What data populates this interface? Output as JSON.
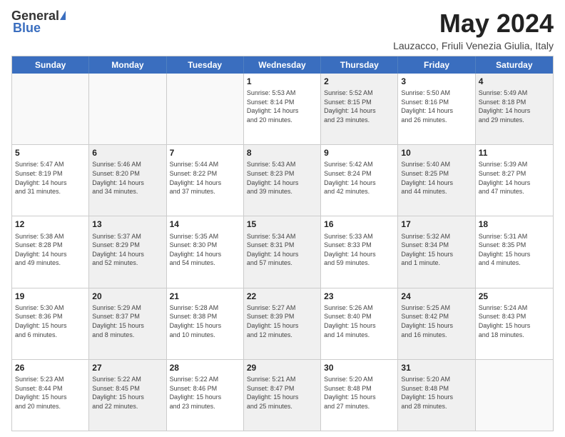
{
  "logo": {
    "general": "General",
    "blue": "Blue"
  },
  "title": "May 2024",
  "subtitle": "Lauzacco, Friuli Venezia Giulia, Italy",
  "header_days": [
    "Sunday",
    "Monday",
    "Tuesday",
    "Wednesday",
    "Thursday",
    "Friday",
    "Saturday"
  ],
  "rows": [
    [
      {
        "day": "",
        "info": "",
        "shaded": false,
        "empty": true
      },
      {
        "day": "",
        "info": "",
        "shaded": false,
        "empty": true
      },
      {
        "day": "",
        "info": "",
        "shaded": false,
        "empty": true
      },
      {
        "day": "1",
        "info": "Sunrise: 5:53 AM\nSunset: 8:14 PM\nDaylight: 14 hours\nand 20 minutes.",
        "shaded": false,
        "empty": false
      },
      {
        "day": "2",
        "info": "Sunrise: 5:52 AM\nSunset: 8:15 PM\nDaylight: 14 hours\nand 23 minutes.",
        "shaded": true,
        "empty": false
      },
      {
        "day": "3",
        "info": "Sunrise: 5:50 AM\nSunset: 8:16 PM\nDaylight: 14 hours\nand 26 minutes.",
        "shaded": false,
        "empty": false
      },
      {
        "day": "4",
        "info": "Sunrise: 5:49 AM\nSunset: 8:18 PM\nDaylight: 14 hours\nand 29 minutes.",
        "shaded": true,
        "empty": false
      }
    ],
    [
      {
        "day": "5",
        "info": "Sunrise: 5:47 AM\nSunset: 8:19 PM\nDaylight: 14 hours\nand 31 minutes.",
        "shaded": false,
        "empty": false
      },
      {
        "day": "6",
        "info": "Sunrise: 5:46 AM\nSunset: 8:20 PM\nDaylight: 14 hours\nand 34 minutes.",
        "shaded": true,
        "empty": false
      },
      {
        "day": "7",
        "info": "Sunrise: 5:44 AM\nSunset: 8:22 PM\nDaylight: 14 hours\nand 37 minutes.",
        "shaded": false,
        "empty": false
      },
      {
        "day": "8",
        "info": "Sunrise: 5:43 AM\nSunset: 8:23 PM\nDaylight: 14 hours\nand 39 minutes.",
        "shaded": true,
        "empty": false
      },
      {
        "day": "9",
        "info": "Sunrise: 5:42 AM\nSunset: 8:24 PM\nDaylight: 14 hours\nand 42 minutes.",
        "shaded": false,
        "empty": false
      },
      {
        "day": "10",
        "info": "Sunrise: 5:40 AM\nSunset: 8:25 PM\nDaylight: 14 hours\nand 44 minutes.",
        "shaded": true,
        "empty": false
      },
      {
        "day": "11",
        "info": "Sunrise: 5:39 AM\nSunset: 8:27 PM\nDaylight: 14 hours\nand 47 minutes.",
        "shaded": false,
        "empty": false
      }
    ],
    [
      {
        "day": "12",
        "info": "Sunrise: 5:38 AM\nSunset: 8:28 PM\nDaylight: 14 hours\nand 49 minutes.",
        "shaded": false,
        "empty": false
      },
      {
        "day": "13",
        "info": "Sunrise: 5:37 AM\nSunset: 8:29 PM\nDaylight: 14 hours\nand 52 minutes.",
        "shaded": true,
        "empty": false
      },
      {
        "day": "14",
        "info": "Sunrise: 5:35 AM\nSunset: 8:30 PM\nDaylight: 14 hours\nand 54 minutes.",
        "shaded": false,
        "empty": false
      },
      {
        "day": "15",
        "info": "Sunrise: 5:34 AM\nSunset: 8:31 PM\nDaylight: 14 hours\nand 57 minutes.",
        "shaded": true,
        "empty": false
      },
      {
        "day": "16",
        "info": "Sunrise: 5:33 AM\nSunset: 8:33 PM\nDaylight: 14 hours\nand 59 minutes.",
        "shaded": false,
        "empty": false
      },
      {
        "day": "17",
        "info": "Sunrise: 5:32 AM\nSunset: 8:34 PM\nDaylight: 15 hours\nand 1 minute.",
        "shaded": true,
        "empty": false
      },
      {
        "day": "18",
        "info": "Sunrise: 5:31 AM\nSunset: 8:35 PM\nDaylight: 15 hours\nand 4 minutes.",
        "shaded": false,
        "empty": false
      }
    ],
    [
      {
        "day": "19",
        "info": "Sunrise: 5:30 AM\nSunset: 8:36 PM\nDaylight: 15 hours\nand 6 minutes.",
        "shaded": false,
        "empty": false
      },
      {
        "day": "20",
        "info": "Sunrise: 5:29 AM\nSunset: 8:37 PM\nDaylight: 15 hours\nand 8 minutes.",
        "shaded": true,
        "empty": false
      },
      {
        "day": "21",
        "info": "Sunrise: 5:28 AM\nSunset: 8:38 PM\nDaylight: 15 hours\nand 10 minutes.",
        "shaded": false,
        "empty": false
      },
      {
        "day": "22",
        "info": "Sunrise: 5:27 AM\nSunset: 8:39 PM\nDaylight: 15 hours\nand 12 minutes.",
        "shaded": true,
        "empty": false
      },
      {
        "day": "23",
        "info": "Sunrise: 5:26 AM\nSunset: 8:40 PM\nDaylight: 15 hours\nand 14 minutes.",
        "shaded": false,
        "empty": false
      },
      {
        "day": "24",
        "info": "Sunrise: 5:25 AM\nSunset: 8:42 PM\nDaylight: 15 hours\nand 16 minutes.",
        "shaded": true,
        "empty": false
      },
      {
        "day": "25",
        "info": "Sunrise: 5:24 AM\nSunset: 8:43 PM\nDaylight: 15 hours\nand 18 minutes.",
        "shaded": false,
        "empty": false
      }
    ],
    [
      {
        "day": "26",
        "info": "Sunrise: 5:23 AM\nSunset: 8:44 PM\nDaylight: 15 hours\nand 20 minutes.",
        "shaded": false,
        "empty": false
      },
      {
        "day": "27",
        "info": "Sunrise: 5:22 AM\nSunset: 8:45 PM\nDaylight: 15 hours\nand 22 minutes.",
        "shaded": true,
        "empty": false
      },
      {
        "day": "28",
        "info": "Sunrise: 5:22 AM\nSunset: 8:46 PM\nDaylight: 15 hours\nand 23 minutes.",
        "shaded": false,
        "empty": false
      },
      {
        "day": "29",
        "info": "Sunrise: 5:21 AM\nSunset: 8:47 PM\nDaylight: 15 hours\nand 25 minutes.",
        "shaded": true,
        "empty": false
      },
      {
        "day": "30",
        "info": "Sunrise: 5:20 AM\nSunset: 8:48 PM\nDaylight: 15 hours\nand 27 minutes.",
        "shaded": false,
        "empty": false
      },
      {
        "day": "31",
        "info": "Sunrise: 5:20 AM\nSunset: 8:48 PM\nDaylight: 15 hours\nand 28 minutes.",
        "shaded": true,
        "empty": false
      },
      {
        "day": "",
        "info": "",
        "shaded": false,
        "empty": true
      }
    ]
  ]
}
